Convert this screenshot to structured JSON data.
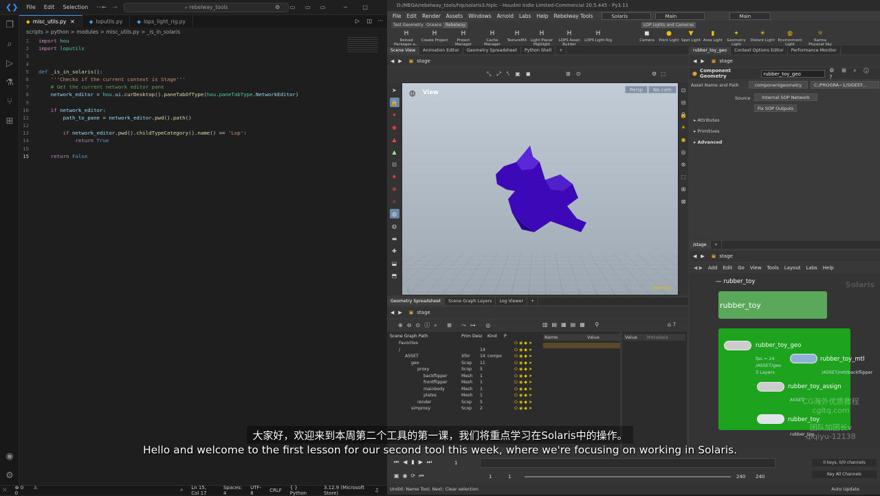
{
  "vscode": {
    "menu": [
      "File",
      "Edit",
      "Selection"
    ],
    "search": "rebelway_tools",
    "tabs": [
      {
        "label": "misc_utils.py",
        "active": true
      },
      {
        "label": "loputils.py"
      },
      {
        "label": "lops_light_rig.py"
      }
    ],
    "breadcrumb": "scripts > python > modules > misc_utils.py > _is_in_solaris",
    "code_lines": [
      "1",
      "2",
      "3",
      "4",
      "5",
      "6",
      "7",
      "8",
      "9",
      "10",
      "11",
      "12",
      "13",
      "14",
      "15"
    ],
    "status": {
      "errors": "0",
      "warnings": "0",
      "position": "Ln 15, Col 17",
      "spaces": "Spaces: 4",
      "encoding": "UTF-8",
      "eol": "CRLF",
      "language": "Python",
      "version": "3.12.9 (Microsoft Store)"
    }
  },
  "houdini": {
    "title": "D:/MEGA/rebelway_tools/hip/solaris3.hiplc - Houdini Indie Limited-Commercial 20.5.445 - Py3.11",
    "menu": [
      "File",
      "Edit",
      "Render",
      "Assets",
      "Windows",
      "Arnold",
      "Labs",
      "Help",
      "Rebelway Tools"
    ],
    "desktop": "Solaris",
    "main": "Main",
    "main2": "Main",
    "shelf_tabs_left": [
      "Test Geometry",
      "Oceans",
      "Rebelway"
    ],
    "shelf_tabs_right": [
      "LOP Lights and Cameras"
    ],
    "shelf_tools": [
      "Reload Packages a...",
      "Create Project",
      "Project Manager",
      "Cache Manager",
      "TextureMX",
      "Light Placer Highlight",
      "LOPS Asset Builder",
      "LOPS Light Rig"
    ],
    "light_tools": [
      "Camera",
      "Point Light",
      "Spot Light",
      "Area Light",
      "Geometry Light",
      "Distant Light",
      "Environment Light",
      "Karma Physical Sky"
    ],
    "pane_tabs_top": [
      "Scene View",
      "Animation Editor",
      "Geometry Spreadsheet",
      "Python Shell"
    ],
    "right_tabs_top": [
      "rubber_toy_geo",
      "Context Options Editor",
      "Performance Monitor"
    ],
    "stage_path": "stage",
    "viewport": {
      "label": "View",
      "persp": "Persp",
      "cam": "No cam",
      "watermark": "rubbertoy"
    },
    "param": {
      "node_type": "Component Geometry",
      "node_name": "rubber_toy_geo",
      "asset_label": "Asset Name and Path",
      "asset_value": "componentgeometry",
      "path_value": "C:/PROGRA~1/SIDEEF...",
      "source_label": "Source",
      "source_value": "Internal SOP Network",
      "fix_btn": "Fix SOP Outputs",
      "sections": [
        "Attributes",
        "Primitives",
        "Advanced"
      ]
    },
    "bottom_tabs": [
      "Geometry Spreadsheet",
      "Scene Graph Layers",
      "Log Viewer"
    ],
    "sg_headers": [
      "Scene Graph Path",
      "Prim",
      "Desc",
      "Kind",
      "P"
    ],
    "sg_rows": [
      {
        "name": "Favorites",
        "prim": "",
        "desc": "",
        "kind": "",
        "indent": 1
      },
      {
        "name": "/",
        "prim": "",
        "desc": "14",
        "kind": "",
        "indent": 1
      },
      {
        "name": "ASSET",
        "prim": "Xfor",
        "desc": "14",
        "kind": "compo",
        "indent": 2
      },
      {
        "name": "geo",
        "prim": "Scop",
        "desc": "11",
        "kind": "",
        "indent": 3
      },
      {
        "name": "proxy",
        "prim": "Scop",
        "desc": "5",
        "kind": "",
        "indent": 4
      },
      {
        "name": "backflipper",
        "prim": "Mesh",
        "desc": "1",
        "kind": "",
        "indent": 5
      },
      {
        "name": "frontflipper",
        "prim": "Mesh",
        "desc": "1",
        "kind": "",
        "indent": 5
      },
      {
        "name": "mainbody",
        "prim": "Mesh",
        "desc": "1",
        "kind": "",
        "indent": 5
      },
      {
        "name": "plates",
        "prim": "Mesh",
        "desc": "1",
        "kind": "",
        "indent": 5
      },
      {
        "name": "render",
        "prim": "Scop",
        "desc": "5",
        "kind": "",
        "indent": 4
      },
      {
        "name": "simproxy",
        "prim": "Scop",
        "desc": "2",
        "kind": "",
        "indent": 3
      }
    ],
    "attr_headers": [
      "Name",
      "Value"
    ],
    "value_headers": [
      "Value",
      "Metadata"
    ],
    "net_path": "/stage",
    "net_menu": [
      "Add",
      "Edit",
      "Go",
      "View",
      "Tools",
      "Layout",
      "Labs",
      "Help"
    ],
    "net_watermark": "Solaris",
    "nodes": {
      "subnet": "rubber_toy",
      "box_label": "rubber_toy",
      "geo": "rubber_toy_geo",
      "geo_info1": "fps = 24",
      "geo_info2": "/ASSET/geo",
      "geo_info3": "3 Layers",
      "mtl": "rubber_toy_mtl",
      "mtl_path": "/ASSET/mtl/backflipper",
      "assign": "rubber_toy_assign",
      "asset_lbl": "ASSET",
      "out": "rubber_toy",
      "out2": "rubber_toy"
    },
    "timeline": {
      "frame": "1",
      "start": "1",
      "start2": "1",
      "end": "240",
      "end2": "240",
      "keys": "0 keys, 0/0 channels",
      "key_btn": "Key All Channels"
    },
    "status": "Undid: Name Tool; Next: Clear selection",
    "auto_update": "Auto Update"
  },
  "subtitles": {
    "cn": "大家好，欢迎来到本周第二个工具的第一课，我们将重点学习在Solaris中的操作。",
    "en": "Hello and welcome to the first lesson for our second tool this week, where we're focusing on working in Solaris."
  },
  "watermark": {
    "line1": "CG海外优质教程",
    "line2": "cgltq.com",
    "line3": "团队加团长v",
    "line4": "qiqiyu-12138"
  }
}
